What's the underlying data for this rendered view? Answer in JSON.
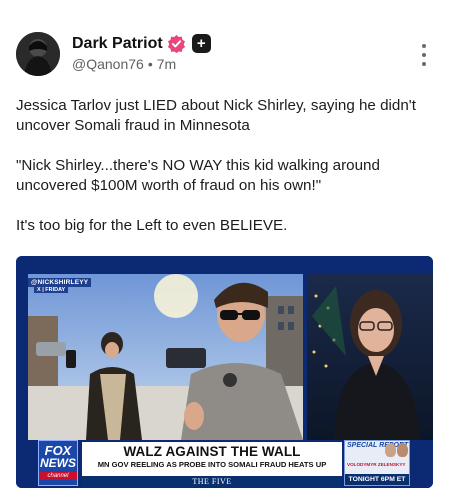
{
  "post": {
    "author_name": "Dark Patriot",
    "handle": "@Qanon76",
    "separator": "•",
    "time": "7m",
    "plus_badge": "+",
    "paragraphs": [
      "Jessica Tarlov just LIED about Nick Shirley, saying he didn't uncover Somali fraud in Minnesota",
      "\"Nick Shirley...there's NO WAY this kid walking around uncovered $100M worth of fraud on his own!\"",
      "It's too big for the Left to even BELIEVE."
    ]
  },
  "media": {
    "social_tag": "@NICKSHIRLEYY",
    "social_tag_sub": "X | FRIDAY",
    "network_line1": "FOX",
    "network_line2": "NEWS",
    "network_line3": "channel",
    "headline": "WALZ AGAINST THE WALL",
    "subheadline": "MN GOV REELING AS PROBE INTO SOMALI FRAUD HEATS UP",
    "show_name": "THE FIVE",
    "promo_label": "SPECIAL REPORT",
    "promo_guest": "VOLODYMYR ZELENSKYY",
    "promo_time": "TONIGHT 6PM ET"
  },
  "colors": {
    "verified": "#e8467c",
    "fox_blue": "#1a47a8",
    "fox_red": "#c8102e"
  },
  "icons": {
    "avatar": "hooded-figure-avatar",
    "verified": "verified-badge-icon",
    "plus": "plus-badge-icon",
    "menu": "more-vertical-icon"
  }
}
